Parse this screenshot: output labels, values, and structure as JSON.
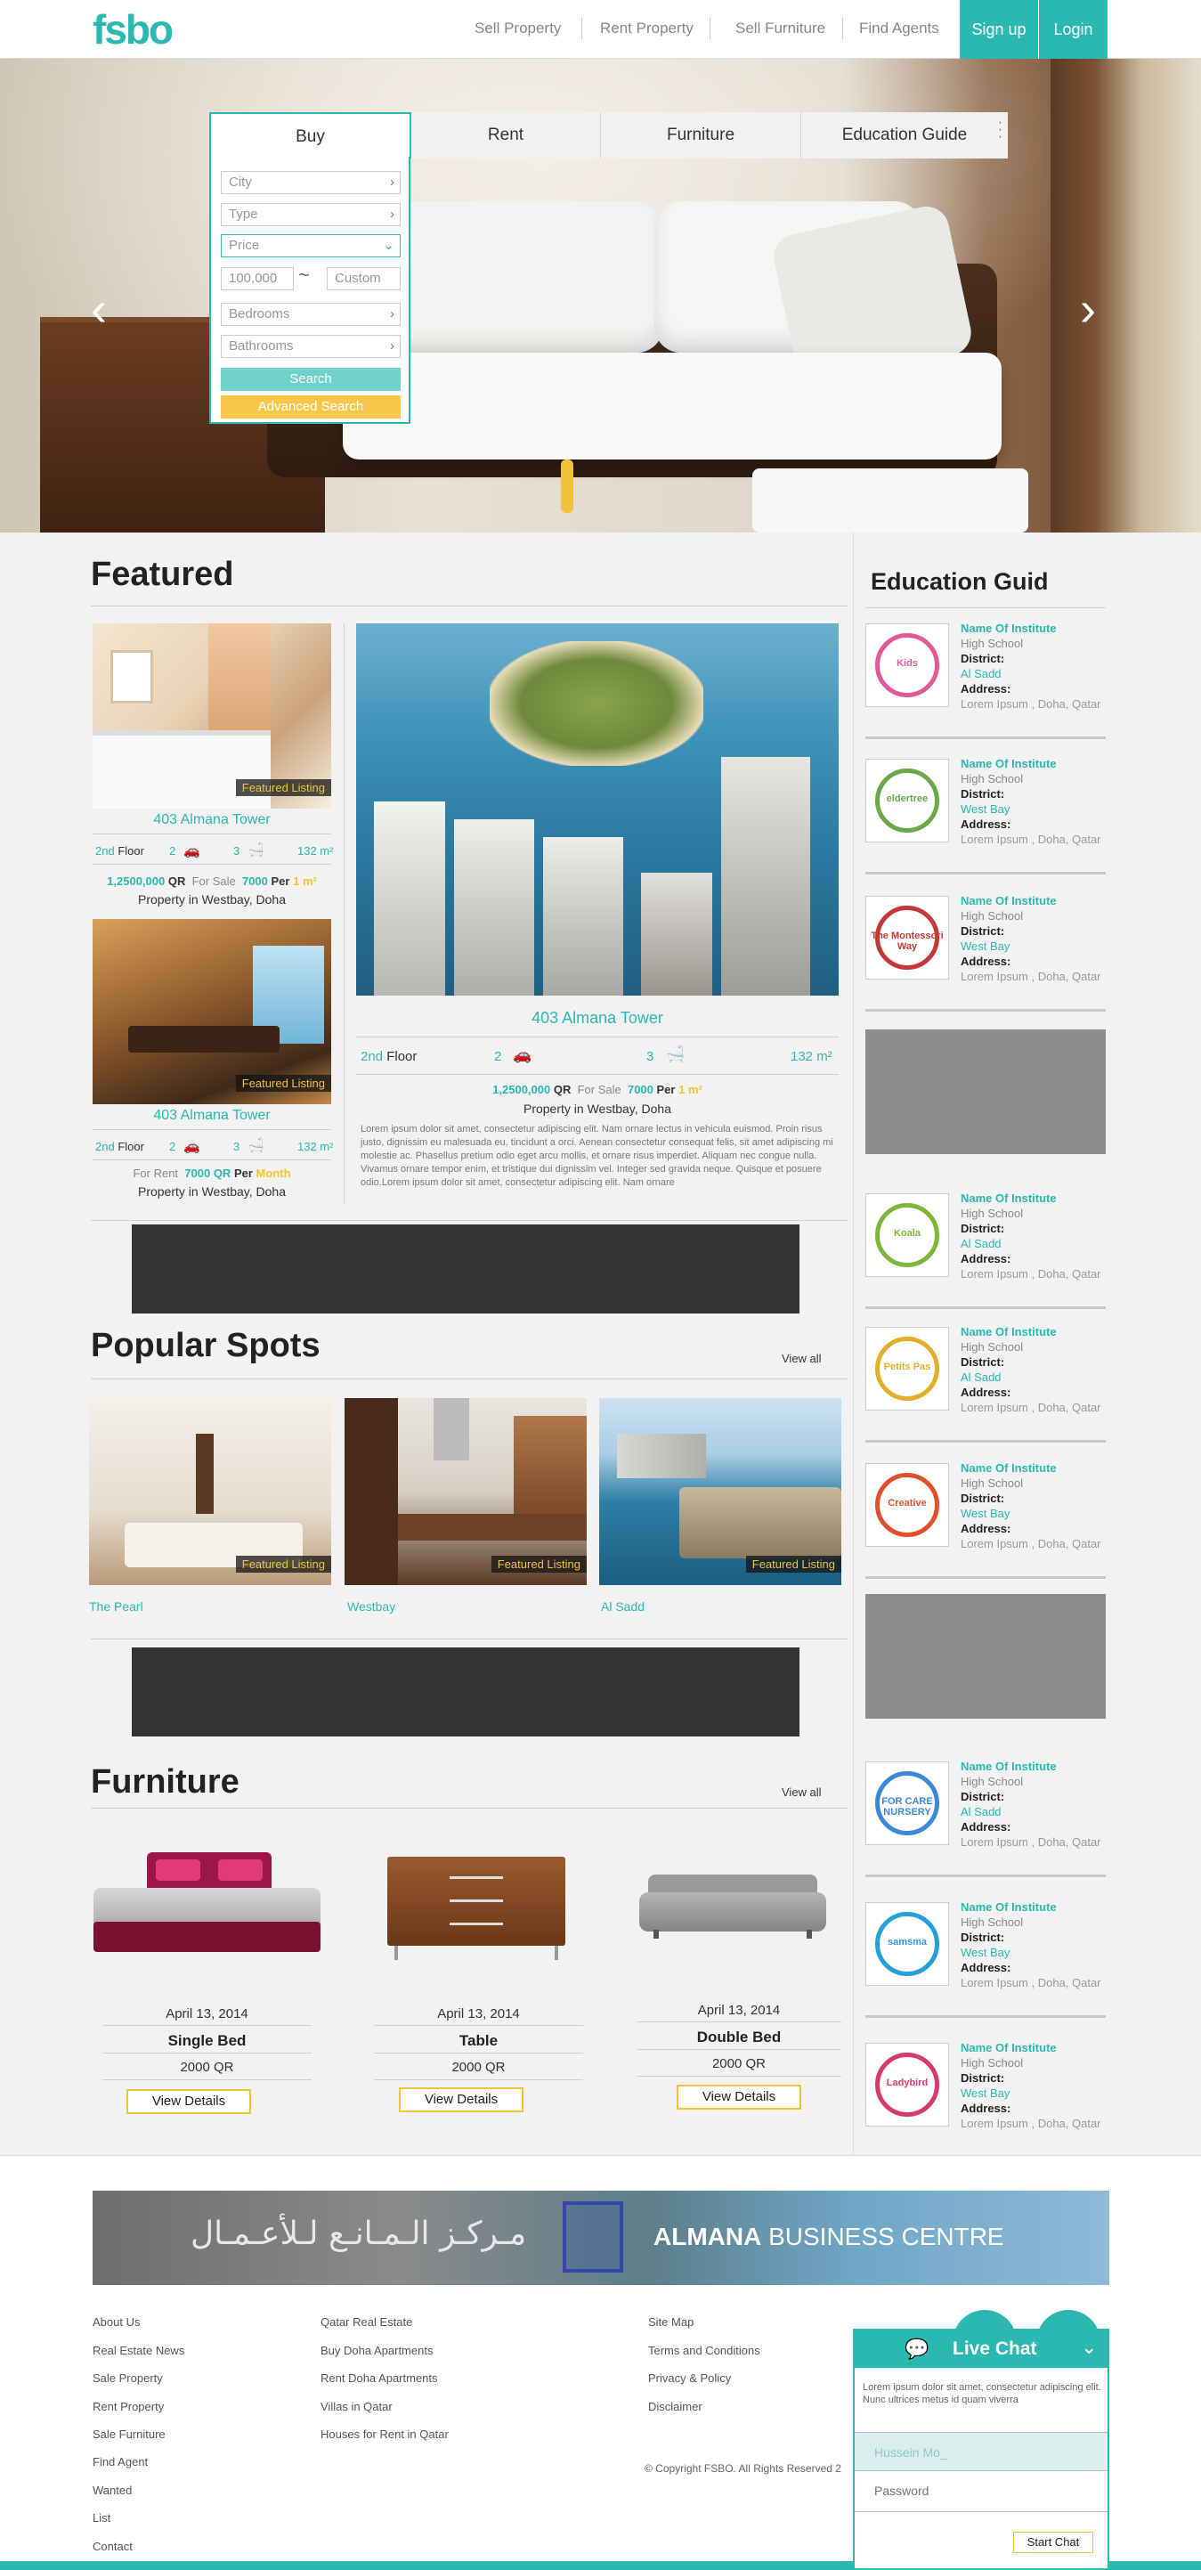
{
  "header": {
    "logo": "fsbo",
    "nav": [
      "Sell Property",
      "Rent Property",
      "Sell Furniture",
      "Find Agents"
    ],
    "signup": "Sign up",
    "login": "Login"
  },
  "search": {
    "tabs": [
      "Buy",
      "Rent",
      "Furniture",
      "Education Guide"
    ],
    "city": "City",
    "type": "Type",
    "price": "Price",
    "price_min": "100,000",
    "price_sep": "~",
    "price_max": "Custom",
    "bedrooms": "Bedrooms",
    "bathrooms": "Bathrooms",
    "search_btn": "Search",
    "advanced_btn": "Advanced Search"
  },
  "featured": {
    "title": "Featured",
    "badge": "Featured Listing",
    "small1": {
      "name": "403 Almana Tower",
      "floor": "2nd",
      "floor_word": "Floor",
      "beds": "2",
      "baths": "3",
      "area": "132 m²",
      "price": "1,2500,000",
      "cur": "QR",
      "for": "For Sale",
      "rent": "7000",
      "per": "Per",
      "unit": "1 m²",
      "loc": "Property in Westbay, Doha"
    },
    "small2": {
      "name": "403 Almana Tower",
      "floor": "2nd",
      "floor_word": "Floor",
      "beds": "2",
      "baths": "3",
      "area": "132 m²",
      "for": "For Rent",
      "rent": "7000 QR",
      "per": "Per",
      "unit": "Month",
      "loc": "Property in Westbay, Doha"
    },
    "big": {
      "name": "403 Almana Tower",
      "floor": "2nd",
      "floor_word": "Floor",
      "beds": "2",
      "baths": "3",
      "area": "132 m²",
      "price": "1,2500,000",
      "cur": "QR",
      "for": "For Sale",
      "rent": "7000",
      "per": "Per",
      "unit": "1 m²",
      "loc": "Property in Westbay, Doha",
      "desc": "Lorem ipsum dolor sit amet, consectetur adipiscing elit. Nam ornare lectus in vehicula euismod. Proin risus justo, dignissim eu malesuada eu, tincidunt a orci. Aenean consectetur consequat felis, sit amet adipiscing mi molestie ac. Phasellus pretium odio eget arcu mollis, et ornare risus imperdiet. Aliquam nec congue nulla. Vivamus ornare tempor enim, et tristique dui dignissim vel. Integer sed gravida neque. Quisque et posuere odio.Lorem ipsum dolor sit amet, consectetur adipiscing elit. Nam ornare"
    }
  },
  "popular": {
    "title": "Popular Spots",
    "view_all": "View all",
    "badge": "Featured Listing",
    "spots": [
      "The Pearl",
      "Westbay",
      "Al Sadd"
    ]
  },
  "furniture": {
    "title": "Furniture",
    "view_all": "View all",
    "btn": "View Details",
    "items": [
      {
        "date": "April 13, 2014",
        "name": "Single Bed",
        "price": "2000 QR"
      },
      {
        "date": "April 13, 2014",
        "name": "Table",
        "price": "2000 QR"
      },
      {
        "date": "April 13, 2014",
        "name": "Double Bed",
        "price": "2000 QR"
      }
    ]
  },
  "education": {
    "title": "Education Guid",
    "name": "Name Of Institute",
    "type": "High School",
    "district_label": "District:",
    "address_label": "Address:",
    "address": "Lorem Ipsum , Doha, Qatar",
    "items": [
      {
        "district": "Al Sadd",
        "logo": "Kids"
      },
      {
        "district": "West Bay",
        "logo": "eldertree"
      },
      {
        "district": "West Bay",
        "logo": "The Montessori Way"
      },
      {
        "district": "Al Sadd",
        "logo": "Koala"
      },
      {
        "district": "Al Sadd",
        "logo": "Petits Pas"
      },
      {
        "district": "West Bay",
        "logo": "Creative"
      },
      {
        "district": "Al Sadd",
        "logo": "FOR CARE NURSERY"
      },
      {
        "district": "West Bay",
        "logo": "samsma"
      },
      {
        "district": "West Bay",
        "logo": "Ladybird"
      }
    ]
  },
  "footer": {
    "banner_ar": "مـركـز الـمـانـع لـلأعـمـال",
    "banner_brand": "ALMANA",
    "banner_en": "BUSINESS CENTRE",
    "col1": [
      "About Us",
      "Real Estate News",
      "Sale Property",
      "Rent Property",
      "Sale Furniture",
      "Find Agent",
      "Wanted",
      "List",
      "Contact"
    ],
    "col2": [
      "Qatar Real Estate",
      "Buy Doha Apartments",
      "Rent Doha Apartments",
      "Villas in Qatar",
      "Houses for Rent in Qatar"
    ],
    "col3": [
      "Site Map",
      "Terms and Conditions",
      "Privacy & Policy",
      "Disclaimer"
    ],
    "copyright": "© Copyright FSBO. All Rights Reserved 2"
  },
  "chat": {
    "title": "Live Chat",
    "text": "Lorem ipsum dolor sit amet, consectetur adipiscing elit. Nunc ultrices metus id quam viverra",
    "name_value": "Hussein Mo_",
    "password_placeholder": "Password",
    "start": "Start Chat"
  },
  "colors": {
    "accent": "#2bb8b0",
    "yellow": "#f2c23a",
    "dark": "#333333"
  }
}
